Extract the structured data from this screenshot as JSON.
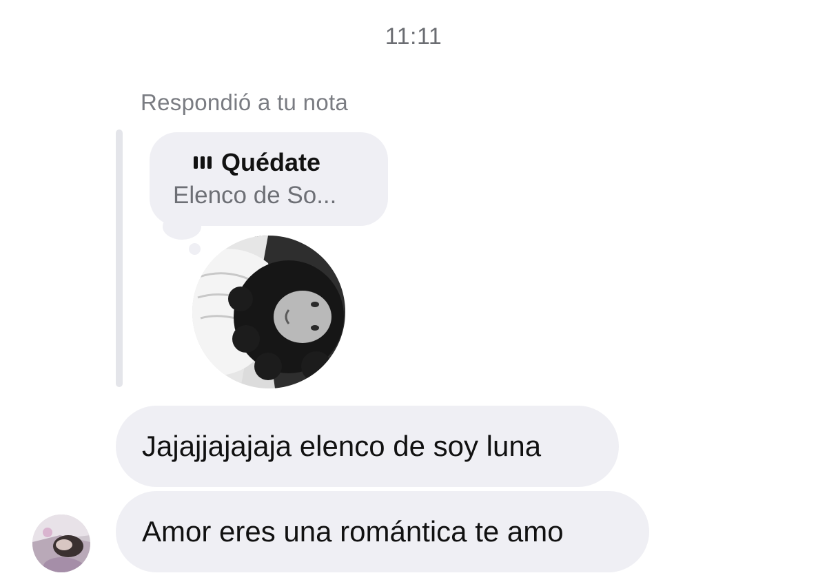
{
  "header": {
    "timestamp": "11:11"
  },
  "note_reply": {
    "caption": "Respondió a tu nota",
    "note_icon": "audio-bars-icon",
    "song_title": "Quédate",
    "song_artist": "Elenco de So..."
  },
  "messages": [
    {
      "text": "Jajajjajajaja elenco de soy luna"
    },
    {
      "text": "Amor eres una romántica te amo"
    }
  ],
  "colors": {
    "bubble": "#efeff4",
    "caption": "#7a7c82",
    "reply_bar": "#e4e5ea"
  }
}
